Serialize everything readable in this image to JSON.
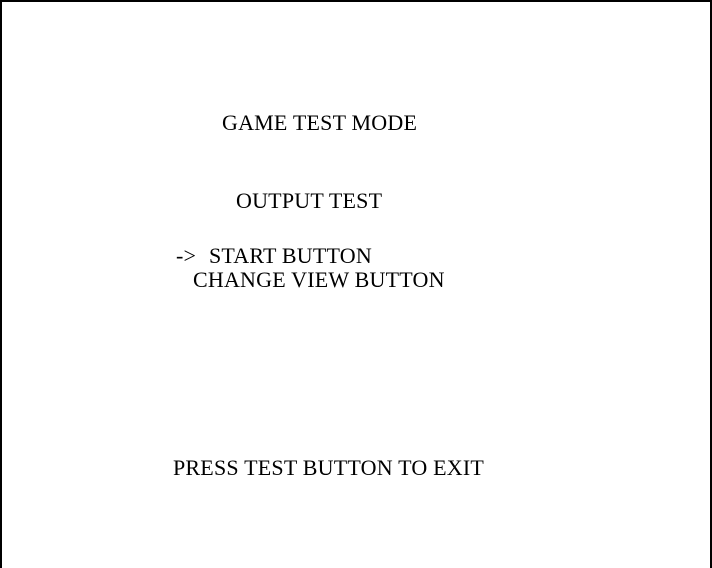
{
  "screen": {
    "title": "GAME TEST MODE",
    "subtitle": "OUTPUT TEST",
    "menu": {
      "cursor": "->",
      "items": [
        {
          "label": "START BUTTON",
          "selected": true
        },
        {
          "label": "CHANGE VIEW BUTTON",
          "selected": false
        }
      ]
    },
    "footer": "PRESS TEST BUTTON TO EXIT"
  },
  "colors": {
    "background": "#ffffff",
    "text": "#000000",
    "border": "#000000"
  }
}
